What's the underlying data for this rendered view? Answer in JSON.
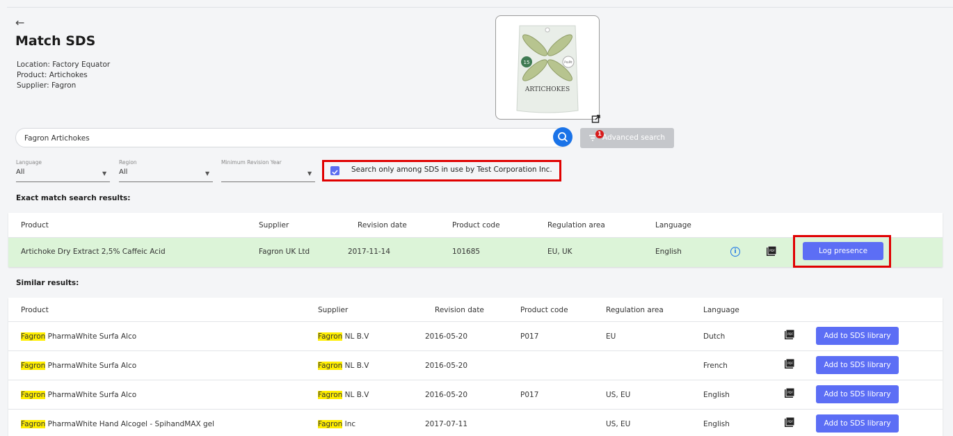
{
  "header": {
    "back_icon": "arrow-left-icon",
    "title": "Match SDS",
    "location": "Location: Factory Equator",
    "product": "Product: Artichokes",
    "supplier": "Supplier: Fagron"
  },
  "product_image": {
    "pouch_text": "ARTICHOKES",
    "badge": "15",
    "brand": "ProPlt"
  },
  "search": {
    "value": "Fagron Artichokes",
    "advanced_label": "Advanced search",
    "advanced_badge": "1"
  },
  "filters": {
    "language_label": "Language",
    "language_value": "All",
    "region_label": "Region",
    "region_value": "All",
    "year_label": "Minimum Revision Year",
    "year_value": "",
    "only_in_use_label": "Search only among SDS in use by Test Corporation Inc.",
    "only_in_use_checked": true
  },
  "exact": {
    "heading": "Exact match search results:",
    "columns": [
      "Product",
      "Supplier",
      "Revision date",
      "Product code",
      "Regulation area",
      "Language"
    ],
    "row": {
      "product": "Artichoke Dry Extract 2,5% Caffeic Acid",
      "supplier": "Fagron UK Ltd",
      "revision_date": "2017-11-14",
      "product_code": "101685",
      "regulation_area": "EU, UK",
      "language": "English",
      "action": "Log presence"
    }
  },
  "similar": {
    "heading": "Similar results:",
    "columns": [
      "Product",
      "Supplier",
      "Revision date",
      "Product code",
      "Regulation area",
      "Language"
    ],
    "highlight": "Fagron",
    "rows": [
      {
        "product_rest": " PharmaWhite Surfa Alco",
        "supplier_rest": " NL B.V",
        "revision_date": "2016-05-20",
        "product_code": "P017",
        "regulation_area": "EU",
        "language": "Dutch",
        "action": "Add to SDS library"
      },
      {
        "product_rest": " PharmaWhite Surfa Alco",
        "supplier_rest": " NL B.V",
        "revision_date": "2016-05-20",
        "product_code": "",
        "regulation_area": "",
        "language": "French",
        "action": "Add to SDS library"
      },
      {
        "product_rest": " PharmaWhite Surfa Alco",
        "supplier_rest": " NL B.V",
        "revision_date": "2016-05-20",
        "product_code": "P017",
        "regulation_area": "US, EU",
        "language": "English",
        "action": "Add to SDS library"
      },
      {
        "product_rest": " PharmaWhite Hand Alcogel - SpihandMAX gel",
        "supplier_rest": " Inc",
        "revision_date": "2017-07-11",
        "product_code": "",
        "regulation_area": "US, EU",
        "language": "English",
        "action": "Add to SDS library"
      }
    ]
  },
  "colors": {
    "accent": "#5c6ef5",
    "match_row": "#dcf4d8",
    "highlight": "#ffee00",
    "annotation": "#e00000"
  }
}
